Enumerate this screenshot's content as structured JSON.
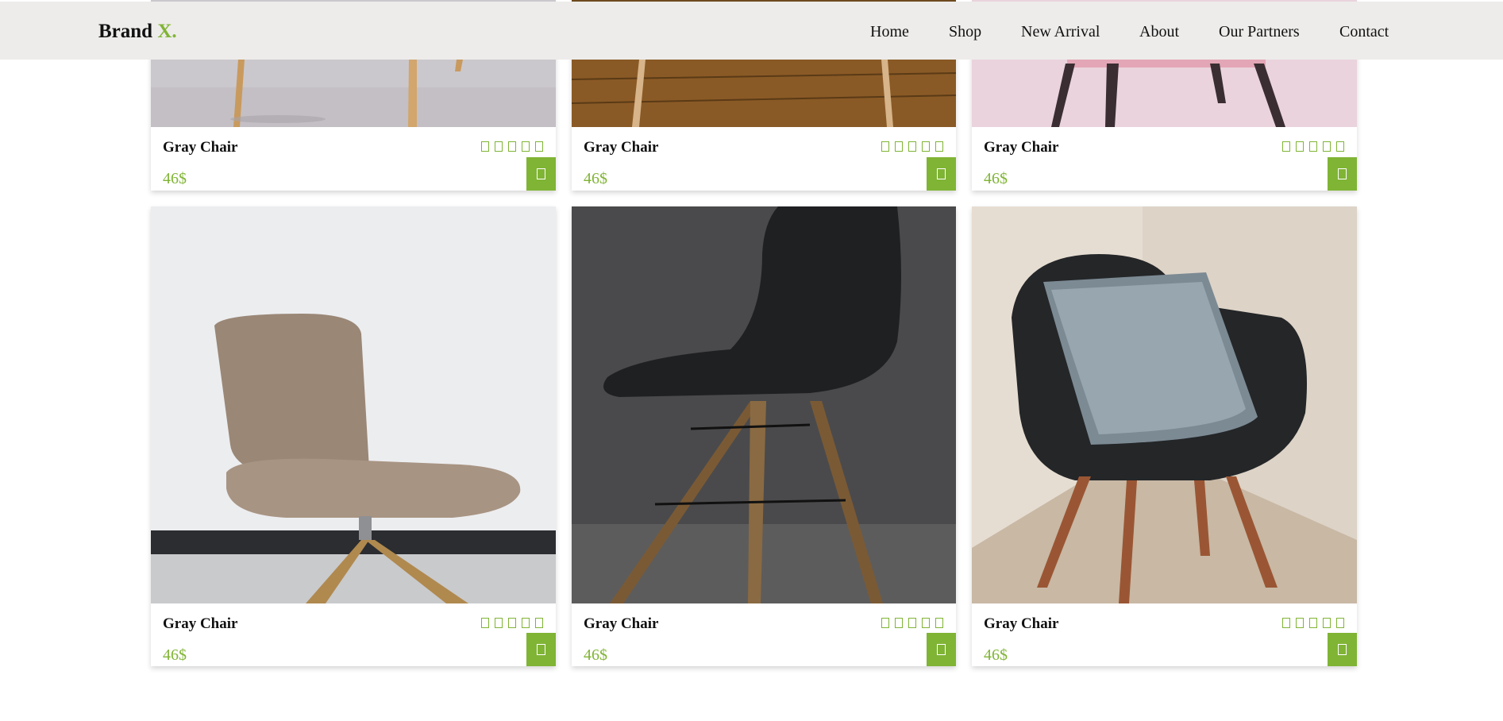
{
  "brand": {
    "name": "Brand",
    "accent": "X."
  },
  "nav": {
    "items": [
      {
        "label": "Home"
      },
      {
        "label": "Shop"
      },
      {
        "label": "New Arrival"
      },
      {
        "label": "About"
      },
      {
        "label": "Our Partners"
      },
      {
        "label": "Contact"
      }
    ]
  },
  "products": [
    {
      "name": "Gray Chair",
      "price": "46$",
      "image": "chair-light-wood-legs"
    },
    {
      "name": "Gray Chair",
      "price": "46$",
      "image": "chair-wood-floor"
    },
    {
      "name": "Gray Chair",
      "price": "46$",
      "image": "chair-pink-dark-legs"
    },
    {
      "name": "Gray Chair",
      "price": "46$",
      "image": "beige-swivel-chair"
    },
    {
      "name": "Gray Chair",
      "price": "46$",
      "image": "black-eames-chair"
    },
    {
      "name": "Gray Chair",
      "price": "46$",
      "image": "black-armchair-pillow"
    }
  ],
  "colors": {
    "accent": "#80b435",
    "navbar_bg": "#edecea"
  }
}
